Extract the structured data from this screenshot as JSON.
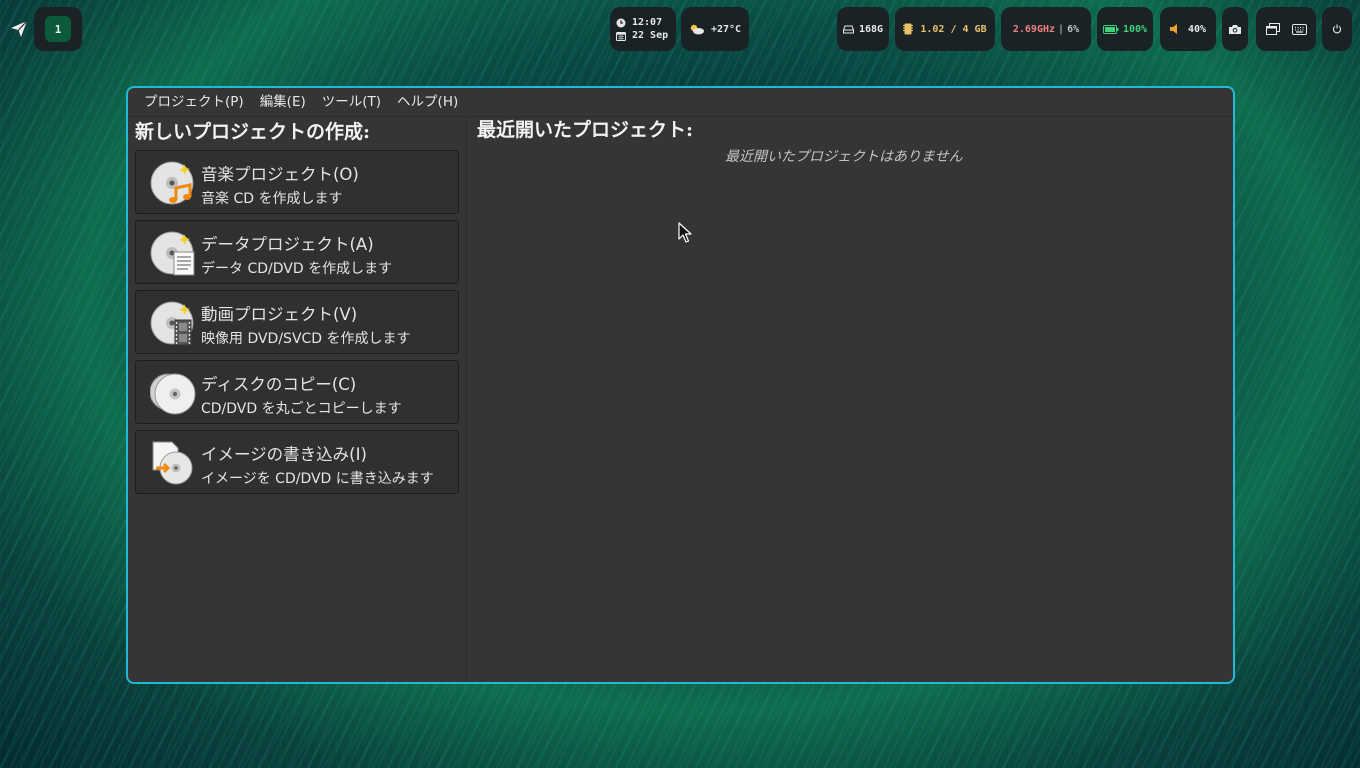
{
  "topbar": {
    "workspace": "1",
    "clock": {
      "time": "12:07",
      "date": "22 Sep"
    },
    "weather": {
      "temp": "+27°C"
    },
    "disk": "168G",
    "ram": "1.02 / 4 GB",
    "cpu": {
      "freq": "2.69GHz",
      "sep": "|",
      "usage": "6%"
    },
    "battery": "100%",
    "volume": "40%"
  },
  "window": {
    "menu": [
      "プロジェクト(P)",
      "編集(E)",
      "ツール(T)",
      "ヘルプ(H)"
    ],
    "new_project_title": "新しいプロジェクトの作成:",
    "actions": [
      {
        "icon": "audio-cd-icon",
        "title": "音楽プロジェクト(O)",
        "desc": "音楽 CD を作成します"
      },
      {
        "icon": "data-cd-icon",
        "title": "データプロジェクト(A)",
        "desc": "データ CD/DVD を作成します"
      },
      {
        "icon": "video-disc-icon",
        "title": "動画プロジェクト(V)",
        "desc": "映像用 DVD/SVCD を作成します"
      },
      {
        "icon": "disc-copy-icon",
        "title": "ディスクのコピー(C)",
        "desc": "CD/DVD を丸ごとコピーします"
      },
      {
        "icon": "image-burn-icon",
        "title": "イメージの書き込み(I)",
        "desc": "イメージを CD/DVD に書き込みます"
      }
    ],
    "recent_title": "最近開いたプロジェクト:",
    "recent_empty": "最近開いたプロジェクトはありません"
  },
  "colors": {
    "window_border": "#22b8d8",
    "window_bg": "#353535",
    "workspace_active": "#0c5a3c",
    "ram_text": "#e8c26a",
    "cpu_text": "#f08080",
    "battery_text": "#3ed27a"
  }
}
